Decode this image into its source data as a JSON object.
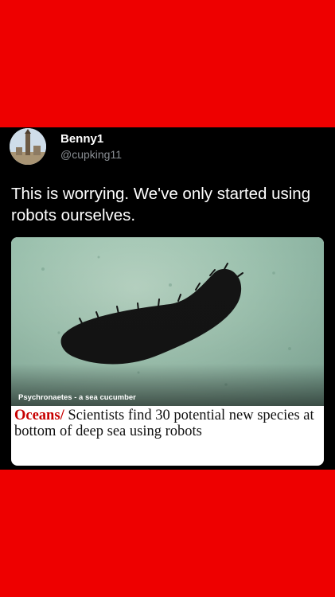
{
  "post": {
    "author_name": "Benny1",
    "author_handle": "@cupking11",
    "text": "This is worrying. We've only started using robots ourselves."
  },
  "article": {
    "image_caption": "Psychronaetes - a sea cucumber",
    "section": "Oceans",
    "separator": "/",
    "headline": "Scientists find 30 potential new species at bottom of deep sea using robots"
  },
  "colors": {
    "frame": "#ee0000",
    "tweet_background": "#000000",
    "section_accent": "#c70000"
  },
  "icons": {
    "avatar": "profile-photo-tower"
  }
}
